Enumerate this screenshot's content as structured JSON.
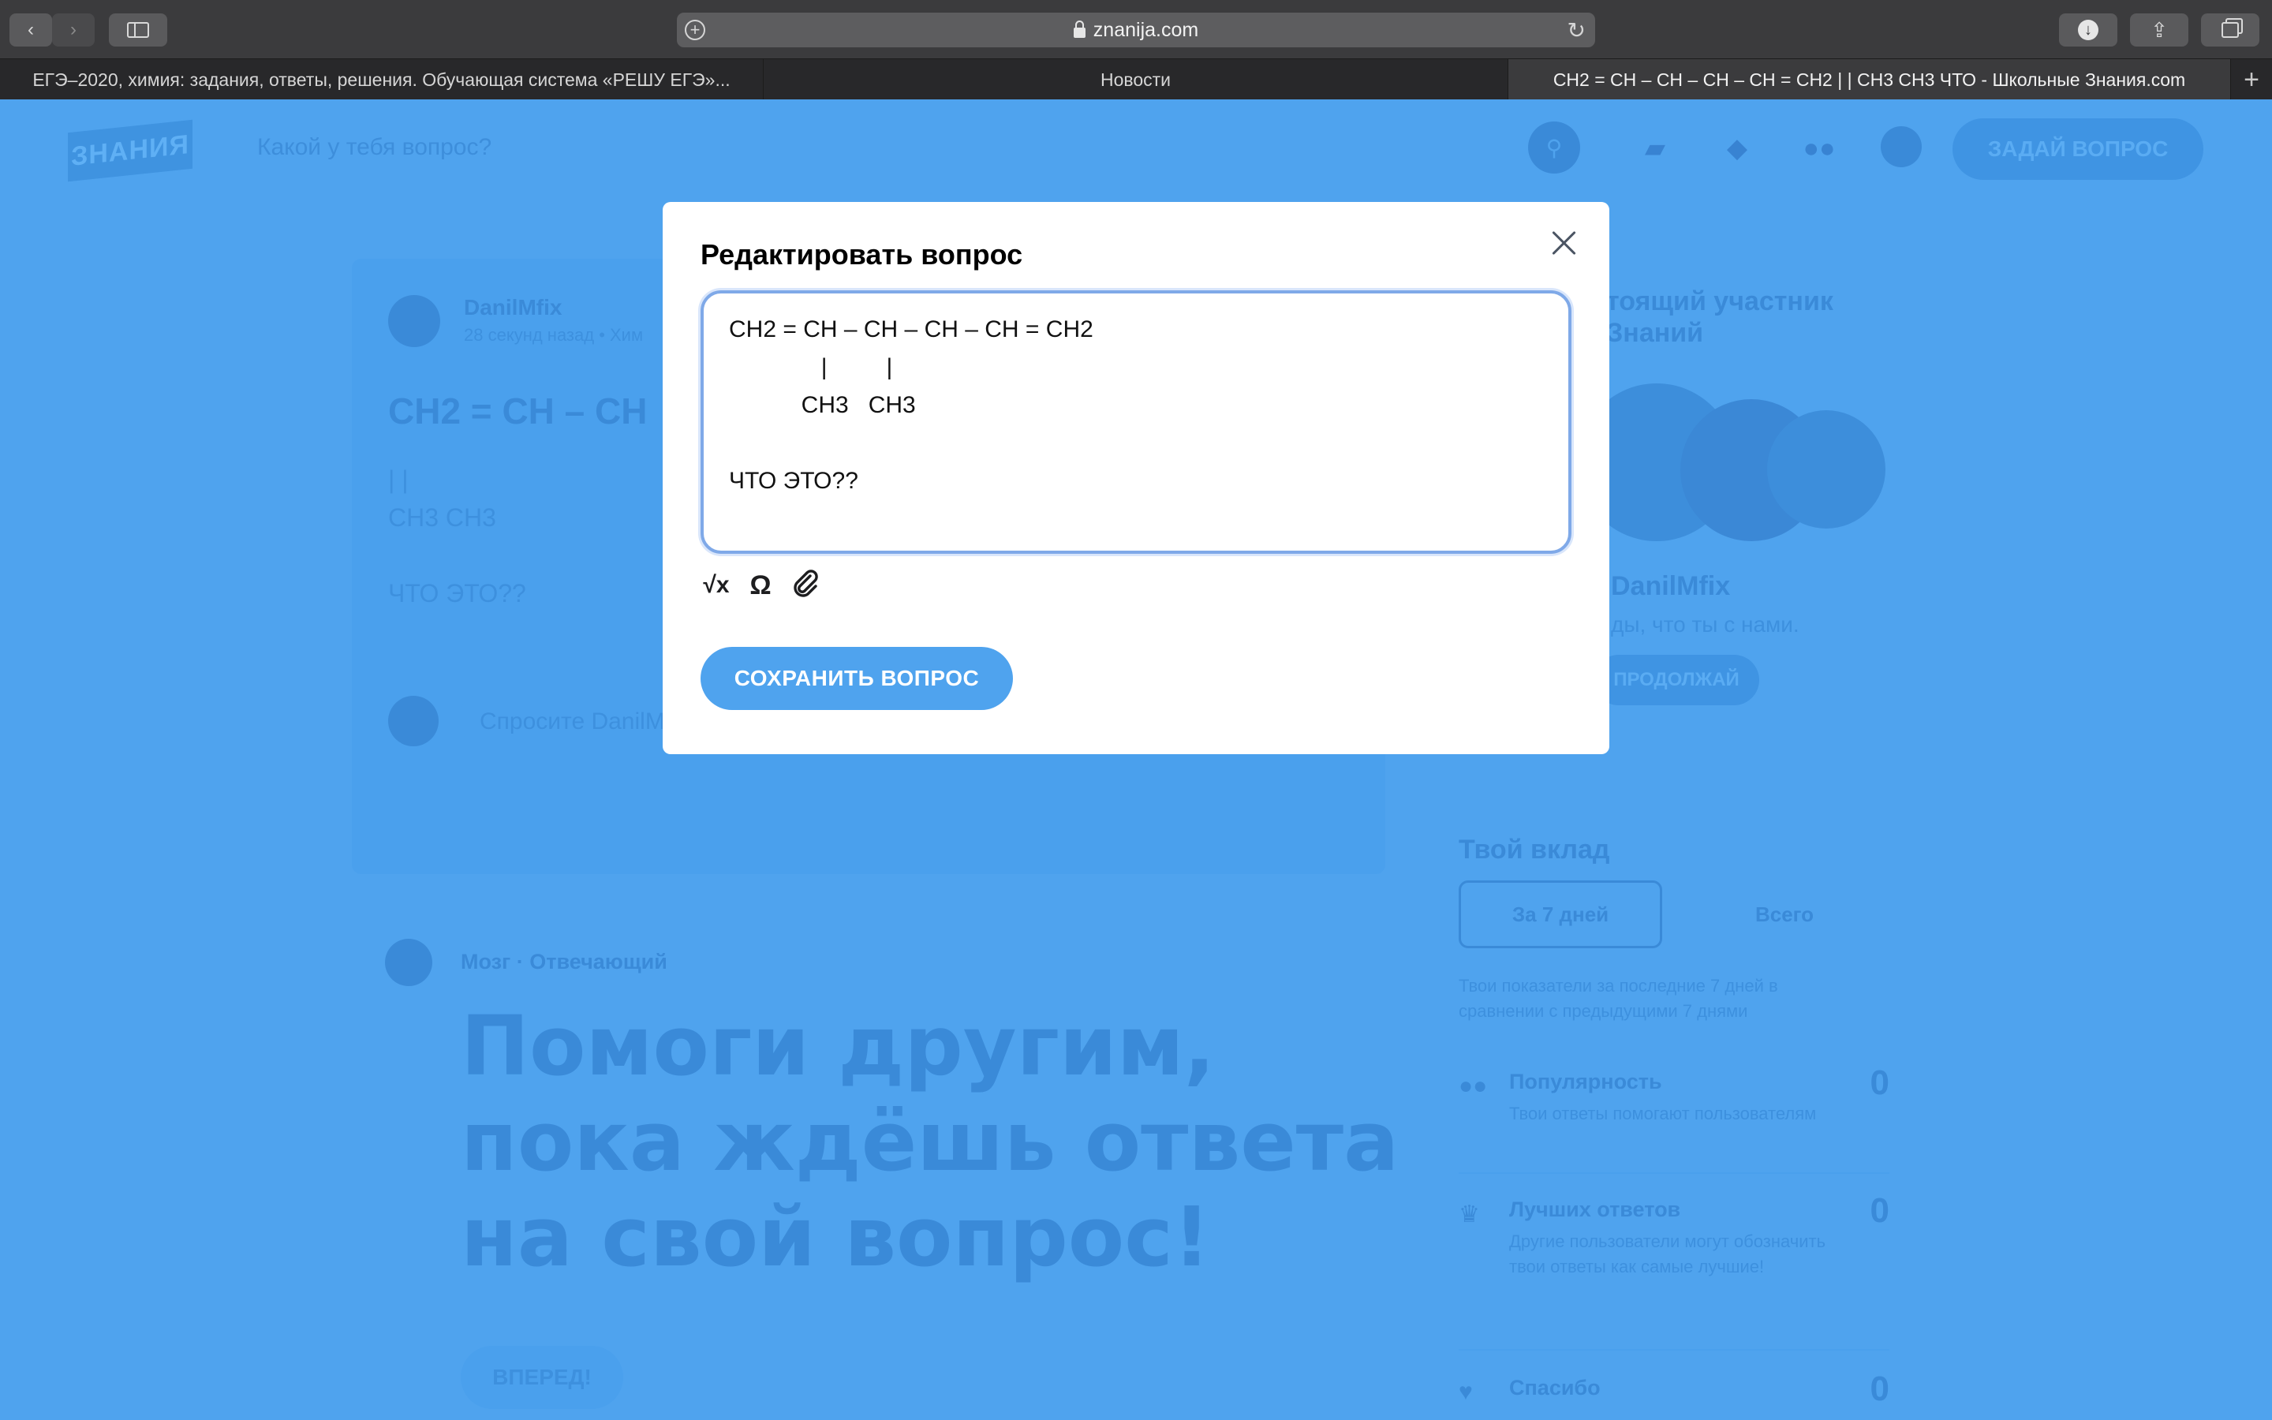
{
  "browser": {
    "url": "znanija.com",
    "tabs": [
      {
        "label": "ЕГЭ–2020, химия: задания, ответы, решения. Обучающая система «РЕШУ ЕГЭ»..."
      },
      {
        "label": "Новости"
      },
      {
        "label": "CH2 = CH – CH – CH – CH = CH2 | | CH3 CH3 ЧТО - Школьные Знания.com"
      }
    ]
  },
  "header": {
    "logo": "ЗНАНИЯ",
    "search_placeholder": "Какой у тебя вопрос?",
    "ask_button": "ЗАДАЙ ВОПРОС"
  },
  "question": {
    "author": "DanilMfix",
    "meta": "28 секунд назад • Хим",
    "title": "CH2 = CH – CH",
    "line1": "| |",
    "line2": "CH3 CH3",
    "line3": "ЧТО ЭТО??",
    "comment_placeholder": "Спросите DanilMfix о заданном вопросе..."
  },
  "helper": {
    "row": "Мозг · Отвечающий",
    "title": "Помоги другим, пока ждёшь ответа на свой вопрос!",
    "go_button": "ВПЕРЕД!"
  },
  "sidebar": {
    "title_line1": "тоящий участник",
    "title_line2": "Знаний",
    "user": "DanilMfix",
    "subtitle": "ды, что ты с нами.",
    "continue_button": "ПРОДОЛЖАЙ"
  },
  "contribution": {
    "title": "Твой вклад",
    "tab_week": "За 7 дней",
    "tab_all": "Всего",
    "desc": "Твои показатели за последние 7 дней в сравнении с предыдущими 7 днями",
    "stats": [
      {
        "name": "Популярность",
        "value": "0",
        "desc": "Твои ответы помогают пользователям"
      },
      {
        "name": "Лучших ответов",
        "value": "0",
        "desc": "Другие пользователи могут обозначить твои ответы как самые лучшие!"
      },
      {
        "name": "Спасибо",
        "value": "0",
        "desc": ""
      }
    ]
  },
  "modal": {
    "title": "Редактировать вопрос",
    "lines": [
      "CH2 = CH – CH – CH – CH = CH2",
      "              |         |",
      "           CH3   CH3",
      "",
      "ЧТО ЭТО??"
    ],
    "tools": {
      "formula": "√x",
      "symbol": "Ω",
      "attach": "⌀"
    },
    "save_button": "СОХРАНИТЬ ВОПРОС"
  },
  "colors": {
    "brand_blue": "#4fa3ee",
    "modal_bg": "#ffffff",
    "editor_border": "#7fa9e8"
  }
}
